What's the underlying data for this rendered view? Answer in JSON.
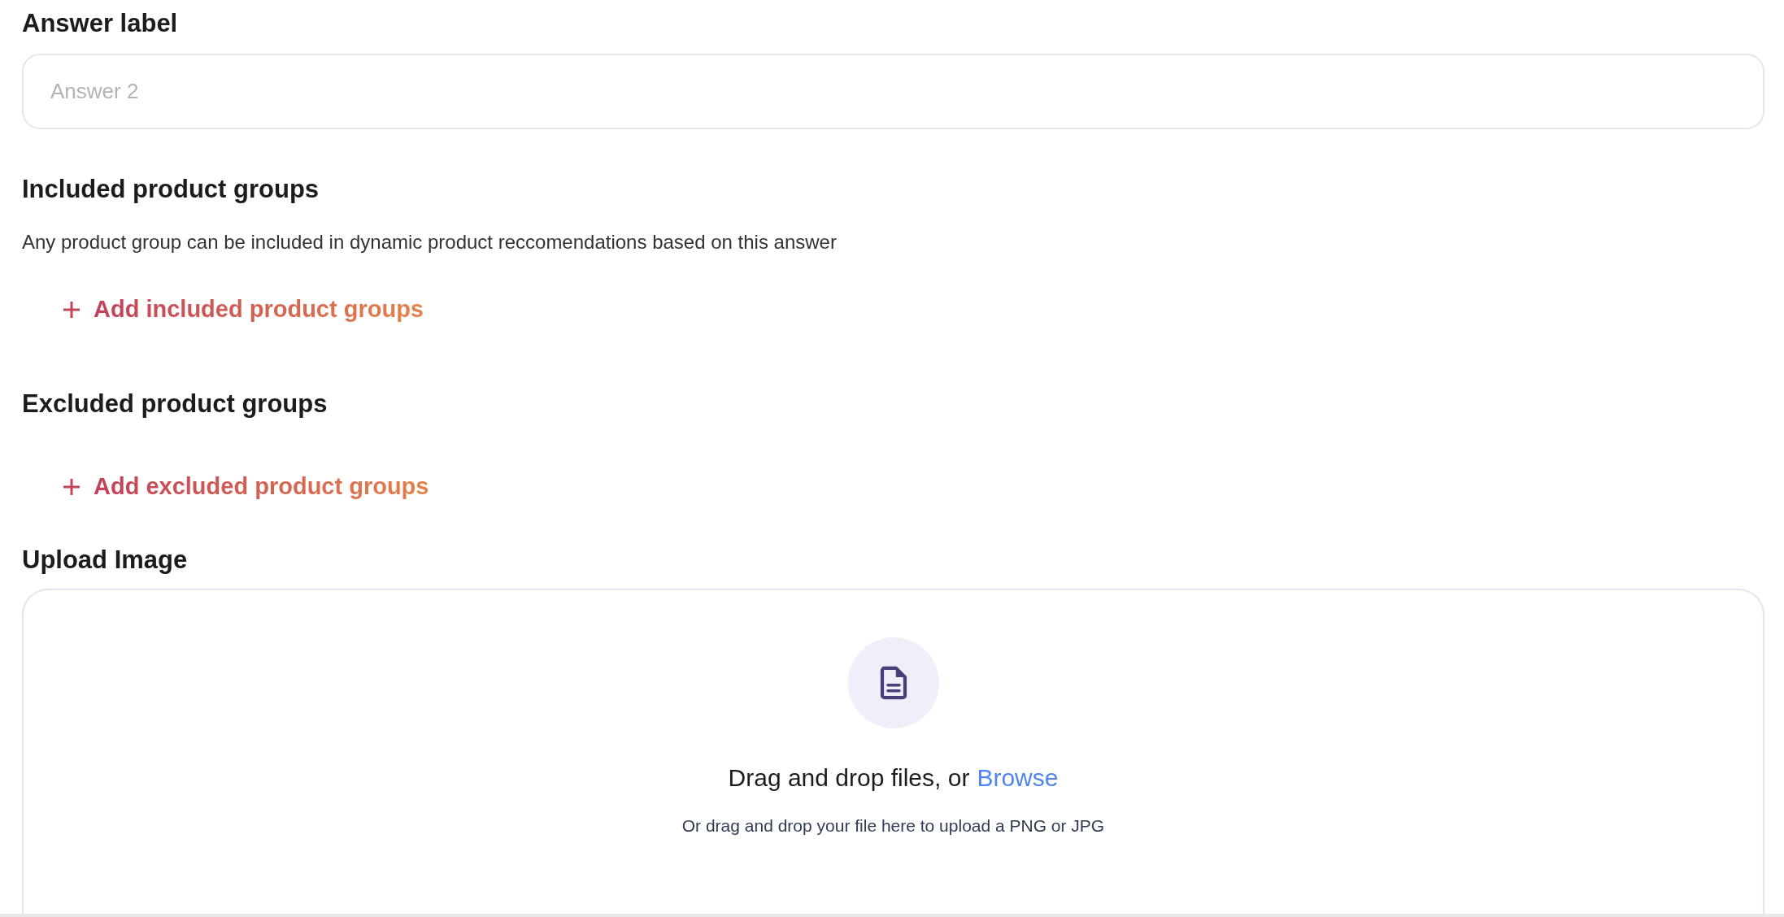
{
  "answer_label": {
    "heading": "Answer label",
    "placeholder": "Answer 2"
  },
  "included_groups": {
    "heading": "Included product groups",
    "description": "Any product group can be included in dynamic product reccomendations based on this answer",
    "add_button": "Add included product groups"
  },
  "excluded_groups": {
    "heading": "Excluded product groups",
    "add_button": "Add excluded product groups"
  },
  "upload_image": {
    "heading": "Upload Image",
    "prompt": "Drag and drop files, or",
    "browse_link": "Browse",
    "hint": "Or drag and drop your file here to upload a PNG or JPG"
  }
}
